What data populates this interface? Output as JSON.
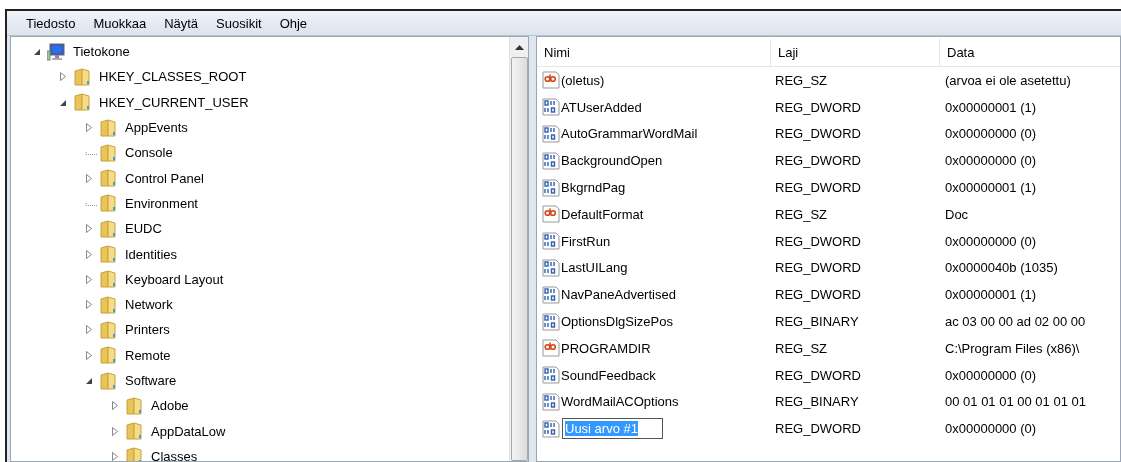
{
  "menu": [
    "Tiedosto",
    "Muokkaa",
    "Näytä",
    "Suosikit",
    "Ohje"
  ],
  "tree": [
    {
      "label": "Tietokone",
      "kind": "computer",
      "expandable": true,
      "expanded": true,
      "children": [
        {
          "label": "HKEY_CLASSES_ROOT",
          "kind": "folder",
          "expandable": true,
          "expanded": false
        },
        {
          "label": "HKEY_CURRENT_USER",
          "kind": "folder",
          "expandable": true,
          "expanded": true,
          "children": [
            {
              "label": "AppEvents",
              "kind": "folder",
              "expandable": true,
              "expanded": false
            },
            {
              "label": "Console",
              "kind": "folder",
              "expandable": false
            },
            {
              "label": "Control Panel",
              "kind": "folder",
              "expandable": true,
              "expanded": false
            },
            {
              "label": "Environment",
              "kind": "folder",
              "expandable": false
            },
            {
              "label": "EUDC",
              "kind": "folder",
              "expandable": true,
              "expanded": false
            },
            {
              "label": "Identities",
              "kind": "folder",
              "expandable": true,
              "expanded": false
            },
            {
              "label": "Keyboard Layout",
              "kind": "folder",
              "expandable": true,
              "expanded": false
            },
            {
              "label": "Network",
              "kind": "folder",
              "expandable": true,
              "expanded": false
            },
            {
              "label": "Printers",
              "kind": "folder",
              "expandable": true,
              "expanded": false
            },
            {
              "label": "Remote",
              "kind": "folder",
              "expandable": true,
              "expanded": false
            },
            {
              "label": "Software",
              "kind": "folder",
              "expandable": true,
              "expanded": true,
              "children": [
                {
                  "label": "Adobe",
                  "kind": "folder",
                  "expandable": true,
                  "expanded": false
                },
                {
                  "label": "AppDataLow",
                  "kind": "folder",
                  "expandable": true,
                  "expanded": false
                },
                {
                  "label": "Classes",
                  "kind": "folder",
                  "expandable": true,
                  "expanded": false
                }
              ]
            }
          ]
        }
      ]
    }
  ],
  "table": {
    "columns": [
      "Nimi",
      "Laji",
      "Data"
    ],
    "rows": [
      {
        "kind": "string",
        "name": "(oletus)",
        "type": "REG_SZ",
        "data": "(arvoa ei ole asetettu)",
        "editing": false
      },
      {
        "kind": "binary",
        "name": "ATUserAdded",
        "type": "REG_DWORD",
        "data": "0x00000001 (1)",
        "editing": false
      },
      {
        "kind": "binary",
        "name": "AutoGrammarWordMail",
        "type": "REG_DWORD",
        "data": "0x00000000 (0)",
        "editing": false
      },
      {
        "kind": "binary",
        "name": "BackgroundOpen",
        "type": "REG_DWORD",
        "data": "0x00000000 (0)",
        "editing": false
      },
      {
        "kind": "binary",
        "name": "BkgrndPag",
        "type": "REG_DWORD",
        "data": "0x00000001 (1)",
        "editing": false
      },
      {
        "kind": "string",
        "name": "DefaultFormat",
        "type": "REG_SZ",
        "data": "Doc",
        "editing": false
      },
      {
        "kind": "binary",
        "name": "FirstRun",
        "type": "REG_DWORD",
        "data": "0x00000000 (0)",
        "editing": false
      },
      {
        "kind": "binary",
        "name": "LastUILang",
        "type": "REG_DWORD",
        "data": "0x0000040b (1035)",
        "editing": false
      },
      {
        "kind": "binary",
        "name": "NavPaneAdvertised",
        "type": "REG_DWORD",
        "data": "0x00000001 (1)",
        "editing": false
      },
      {
        "kind": "binary",
        "name": "OptionsDlgSizePos",
        "type": "REG_BINARY",
        "data": "ac 03 00 00 ad 02 00 00",
        "editing": false
      },
      {
        "kind": "string",
        "name": "PROGRAMDIR",
        "type": "REG_SZ",
        "data": "C:\\Program Files (x86)\\",
        "editing": false
      },
      {
        "kind": "binary",
        "name": "SoundFeedback",
        "type": "REG_DWORD",
        "data": "0x00000000 (0)",
        "editing": false
      },
      {
        "kind": "binary",
        "name": "WordMailACOptions",
        "type": "REG_BINARY",
        "data": "00 01 01 01 00 01 01 01",
        "editing": false
      },
      {
        "kind": "binary",
        "name": "Uusi arvo #1",
        "type": "REG_DWORD",
        "data": "0x00000000 (0)",
        "editing": true
      }
    ]
  }
}
